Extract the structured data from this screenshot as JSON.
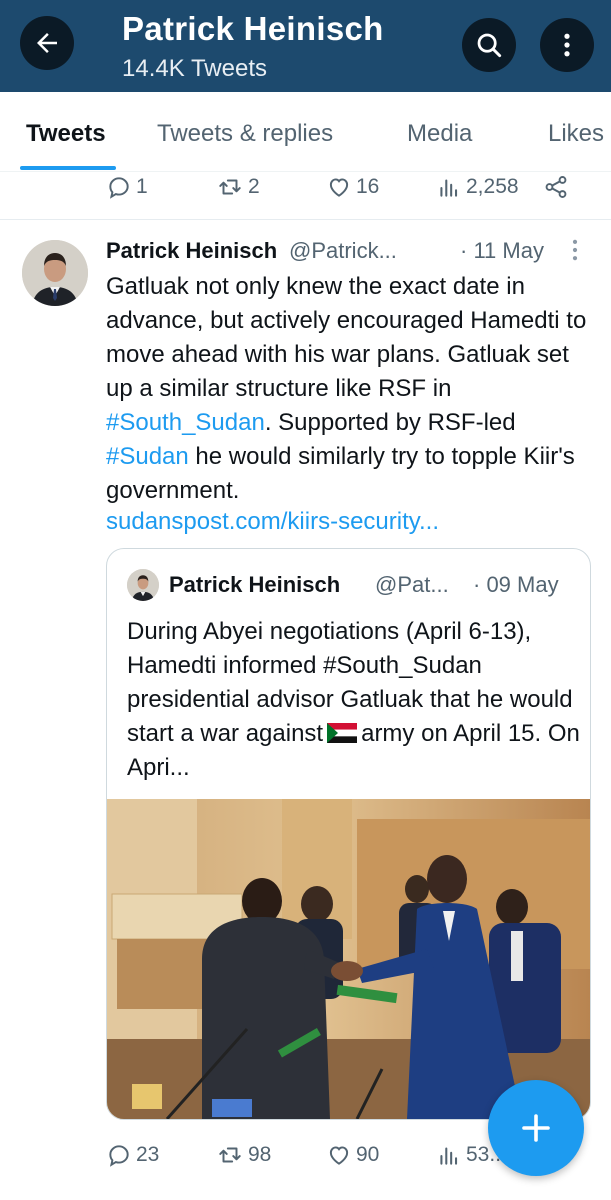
{
  "header": {
    "title": "Patrick Heinisch",
    "subtitle": "14.4K Tweets",
    "back_icon": "arrow-left-icon",
    "search_icon": "search-icon",
    "more_icon": "more-vertical-icon",
    "background": "#1d4a6e"
  },
  "tabs": [
    {
      "label": "Tweets",
      "active": true
    },
    {
      "label": "Tweets & replies",
      "active": false
    },
    {
      "label": "Media",
      "active": false
    },
    {
      "label": "Likes",
      "active": false
    }
  ],
  "previous_tweet_actions": {
    "replies": "1",
    "retweets": "2",
    "likes": "16",
    "views": "2,258"
  },
  "tweet": {
    "author": "Patrick Heinisch",
    "handle": "@Patrick...",
    "date": "· 11 May",
    "body_1": "Gatluak not only knew the exact date in advance, but actively encouraged Hamedti to move ahead with his war plans. Gatluak set up a similar structure like RSF in ",
    "tag_1": "#South_Sudan",
    "body_2": ". Supported by RSF-led ",
    "tag_2": "#Sudan",
    "body_3": " he would similarly try to topple Kiir's government.",
    "link": "sudanspost.com/kiirs-security...",
    "quote": {
      "author": "Patrick Heinisch",
      "handle": "@Pat...",
      "date": "· 09 May",
      "body_1": "During Abyei negotiations (April 6-13), Hamedti informed #South_Sudan presidential advisor Gatluak that he would start a war against",
      "flag_icon": "sudan-flag-icon",
      "body_2": "army on April 15. On Apri..."
    },
    "actions": {
      "replies": "23",
      "retweets": "98",
      "likes": "90",
      "views": "53..."
    }
  },
  "fab_icon": "plus-icon",
  "colors": {
    "accent": "#1d9bf0",
    "text": "#0f1419",
    "muted": "#536471"
  }
}
